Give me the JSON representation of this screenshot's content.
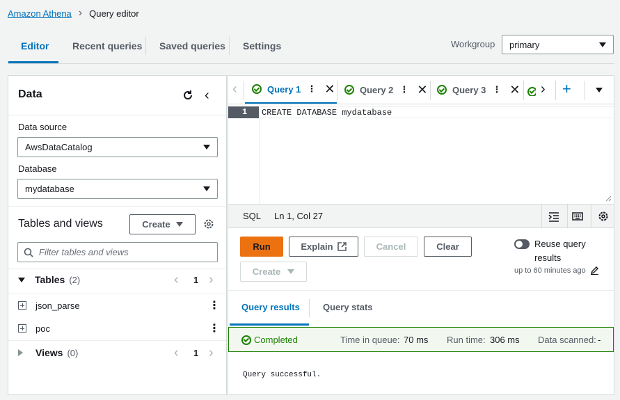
{
  "breadcrumb": {
    "root": "Amazon Athena",
    "sep": "›",
    "current": "Query editor"
  },
  "top_tabs": [
    "Editor",
    "Recent queries",
    "Saved queries",
    "Settings"
  ],
  "workgroup": {
    "label": "Workgroup",
    "value": "primary"
  },
  "data_panel": {
    "title": "Data",
    "data_source_label": "Data source",
    "data_source_value": "AwsDataCatalog",
    "database_label": "Database",
    "database_value": "mydatabase",
    "tables_views_title": "Tables and views",
    "create_label": "Create",
    "filter_placeholder": "Filter tables and views",
    "tables_label": "Tables",
    "tables_count": "(2)",
    "tables_page": "1",
    "tables": [
      "json_parse",
      "poc"
    ],
    "views_label": "Views",
    "views_count": "(0)",
    "views_page": "1"
  },
  "query_tabs": [
    "Query 1",
    "Query 2",
    "Query 3"
  ],
  "editor": {
    "line_number": "1",
    "code": "CREATE DATABASE mydatabase"
  },
  "status_bar": {
    "language": "SQL",
    "position": "Ln 1, Col 27"
  },
  "actions": {
    "run": "Run",
    "explain": "Explain",
    "cancel": "Cancel",
    "clear": "Clear",
    "create": "Create",
    "reuse_label": "Reuse query results",
    "reuse_sub": "up to 60 minutes ago"
  },
  "result_tabs": [
    "Query results",
    "Query stats"
  ],
  "result_status": {
    "status": "Completed",
    "time_in_queue_label": "Time in queue:",
    "time_in_queue": "70 ms",
    "run_time_label": "Run time:",
    "run_time": "306 ms",
    "data_scanned_label": "Data scanned:",
    "data_scanned": "-"
  },
  "result_message": "Query successful.",
  "colors": {
    "accent": "#0073bb",
    "run": "#ec7211",
    "success": "#1d8102"
  }
}
